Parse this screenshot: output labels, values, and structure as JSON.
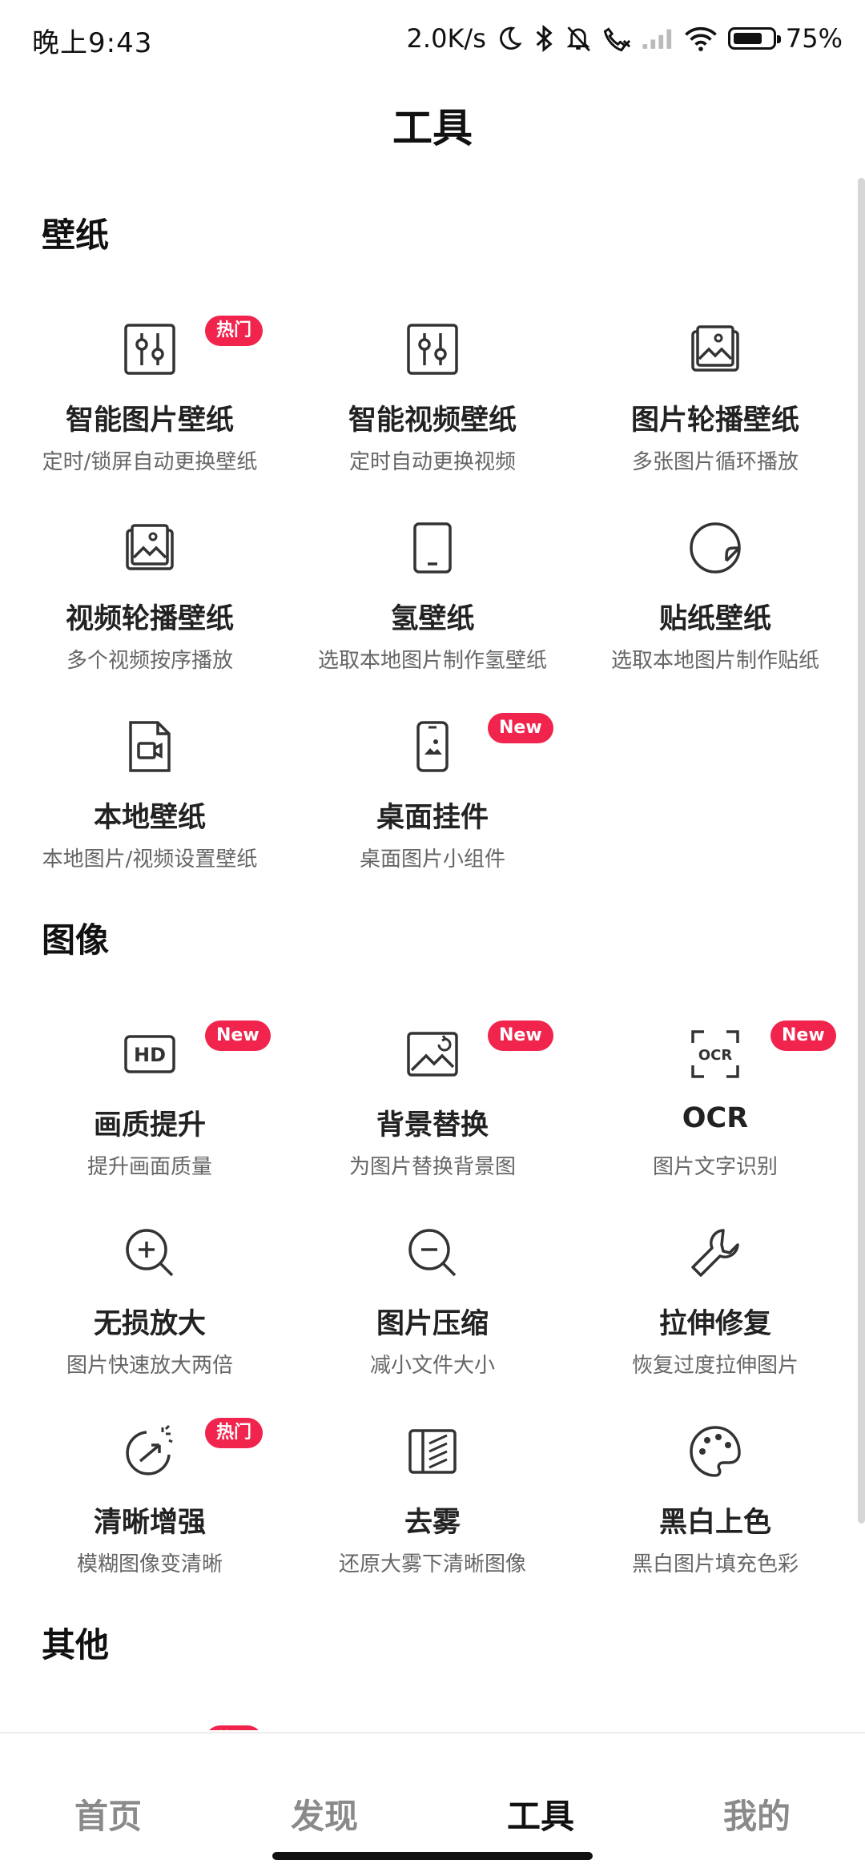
{
  "status_bar": {
    "time": "晚上9:43",
    "network_speed": "2.0K/s",
    "battery_percent": "75%",
    "battery_level": 0.75,
    "icons": [
      "moon-icon",
      "bluetooth-icon",
      "bell-off-icon",
      "call-icon",
      "signal-icon",
      "wifi-icon",
      "battery-icon"
    ]
  },
  "header": {
    "title": "工具"
  },
  "sections": {
    "wallpaper": {
      "title": "壁纸",
      "items": [
        {
          "name": "智能图片壁纸",
          "desc": "定时/锁屏自动更换壁纸",
          "badge": "热门",
          "icon": "sliders-icon"
        },
        {
          "name": "智能视频壁纸",
          "desc": "定时自动更换视频",
          "icon": "sliders-icon"
        },
        {
          "name": "图片轮播壁纸",
          "desc": "多张图片循环播放",
          "icon": "image-stack-icon"
        },
        {
          "name": "视频轮播壁纸",
          "desc": "多个视频按序播放",
          "icon": "image-stack-icon"
        },
        {
          "name": "氢壁纸",
          "desc": "选取本地图片制作氢壁纸",
          "icon": "tablet-icon"
        },
        {
          "name": "贴纸壁纸",
          "desc": "选取本地图片制作贴纸",
          "icon": "sticker-icon"
        },
        {
          "name": "本地壁纸",
          "desc": "本地图片/视频设置壁纸",
          "icon": "video-file-icon"
        },
        {
          "name": "桌面挂件",
          "desc": "桌面图片小组件",
          "badge": "New",
          "icon": "phone-widget-icon"
        }
      ]
    },
    "image": {
      "title": "图像",
      "items": [
        {
          "name": "画质提升",
          "desc": "提升画面质量",
          "badge": "New",
          "icon": "hd-icon"
        },
        {
          "name": "背景替换",
          "desc": "为图片替换背景图",
          "badge": "New",
          "icon": "image-replace-icon"
        },
        {
          "name": "OCR",
          "desc": "图片文字识别",
          "badge": "New",
          "icon": "ocr-icon"
        },
        {
          "name": "无损放大",
          "desc": "图片快速放大两倍",
          "icon": "zoom-in-icon"
        },
        {
          "name": "图片压缩",
          "desc": "减小文件大小",
          "icon": "zoom-out-icon"
        },
        {
          "name": "拉伸修复",
          "desc": "恢复过度拉伸图片",
          "icon": "wrench-icon"
        },
        {
          "name": "清晰增强",
          "desc": "模糊图像变清晰",
          "badge": "热门",
          "icon": "sparkle-enhance-icon"
        },
        {
          "name": "去雾",
          "desc": "还原大雾下清晰图像",
          "icon": "dehaze-icon"
        },
        {
          "name": "黑白上色",
          "desc": "黑白图片填充色彩",
          "icon": "palette-icon"
        }
      ]
    },
    "other": {
      "title": "其他",
      "items": [
        {
          "name": "",
          "desc": "",
          "badge": "热门",
          "icon": "face-scan-icon"
        },
        {
          "name": "",
          "desc": "",
          "icon": "image-stack-icon"
        },
        {
          "name": "",
          "desc": "",
          "icon": "crop-icon"
        }
      ]
    }
  },
  "bottom_nav": {
    "items": [
      "首页",
      "发现",
      "工具",
      "我的"
    ],
    "active": "工具"
  }
}
